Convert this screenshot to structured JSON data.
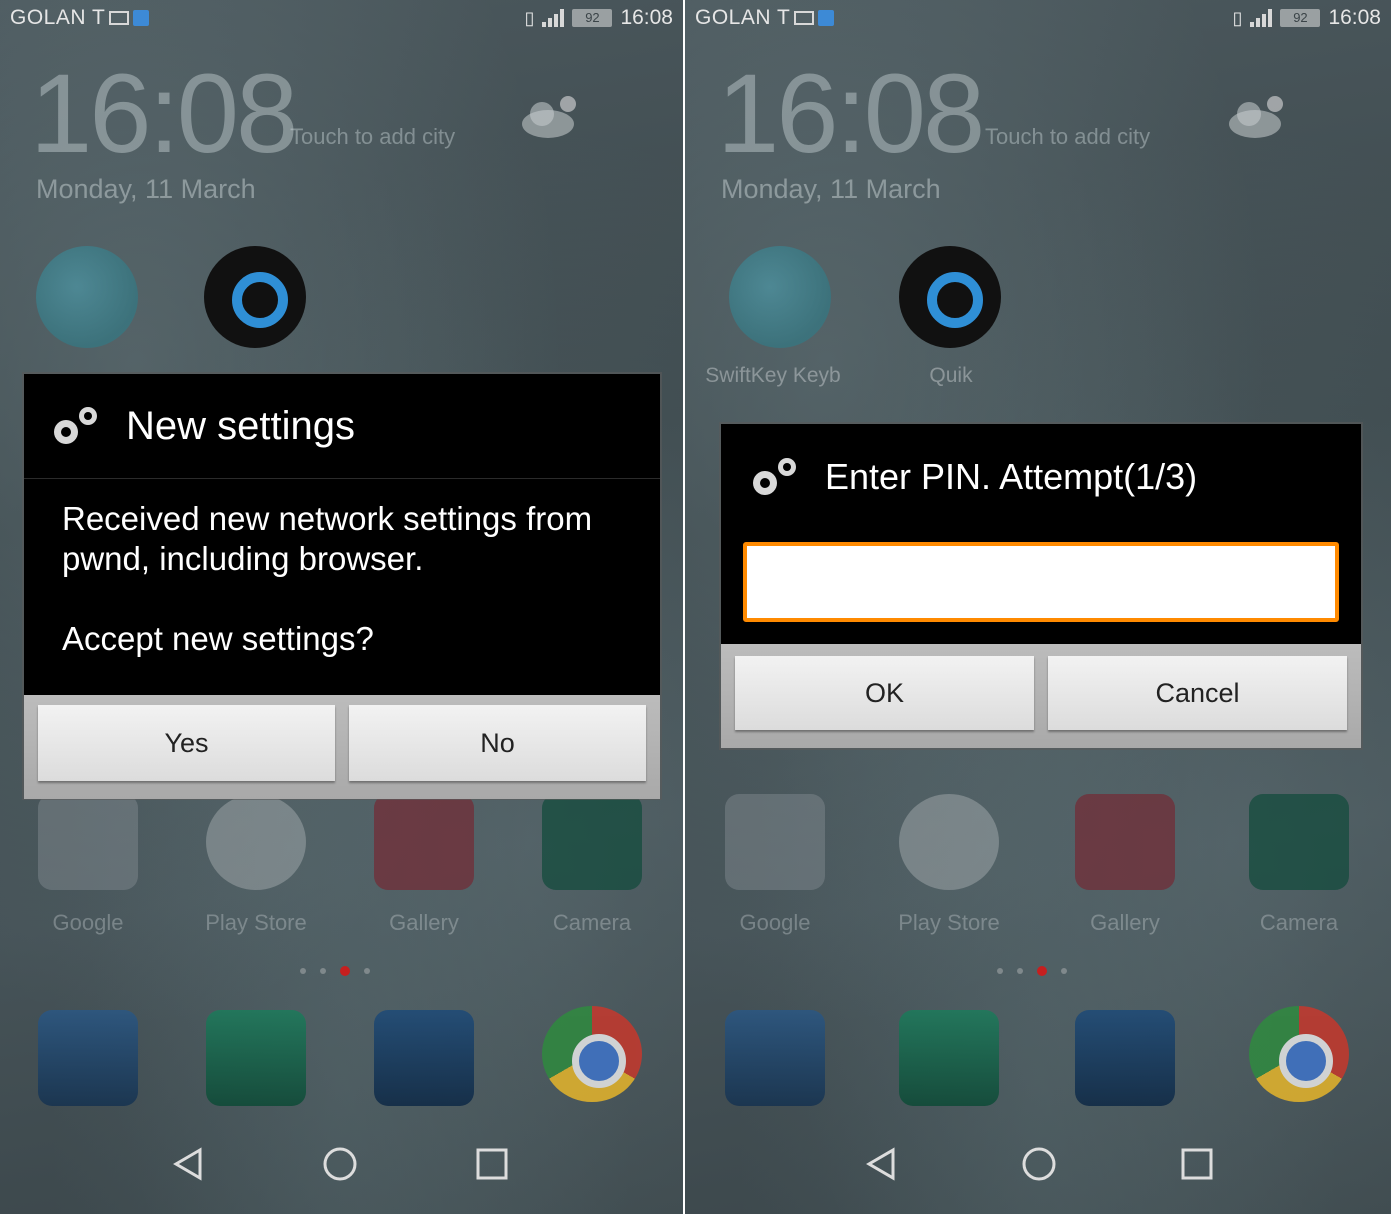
{
  "status_bar": {
    "carrier": "GOLAN T",
    "battery": "92",
    "time": "16:08"
  },
  "lockscreen": {
    "clock": "16:08",
    "add_city": "Touch to add city",
    "date": "Monday, 11 March"
  },
  "apps": {
    "swiftkey": "SwiftKey Keyb",
    "quik": "Quik",
    "row": [
      "Google",
      "Play Store",
      "Gallery",
      "Camera"
    ]
  },
  "dialog_left": {
    "title": "New settings",
    "message": "Received new network settings from pwnd, including browser.",
    "question": "Accept new settings?",
    "yes_label": "Yes",
    "no_label": "No"
  },
  "dialog_right": {
    "title": "Enter PIN. Attempt(1/3)",
    "pin_value": "",
    "ok_label": "OK",
    "cancel_label": "Cancel"
  },
  "colors": {
    "input_border": "#ff8a00",
    "dialog_bg": "#000000",
    "active_page_dot": "#c61f1f"
  },
  "icons": [
    "gear-icon",
    "weather-cloud-icon",
    "back-icon",
    "home-icon",
    "recents-icon"
  ]
}
